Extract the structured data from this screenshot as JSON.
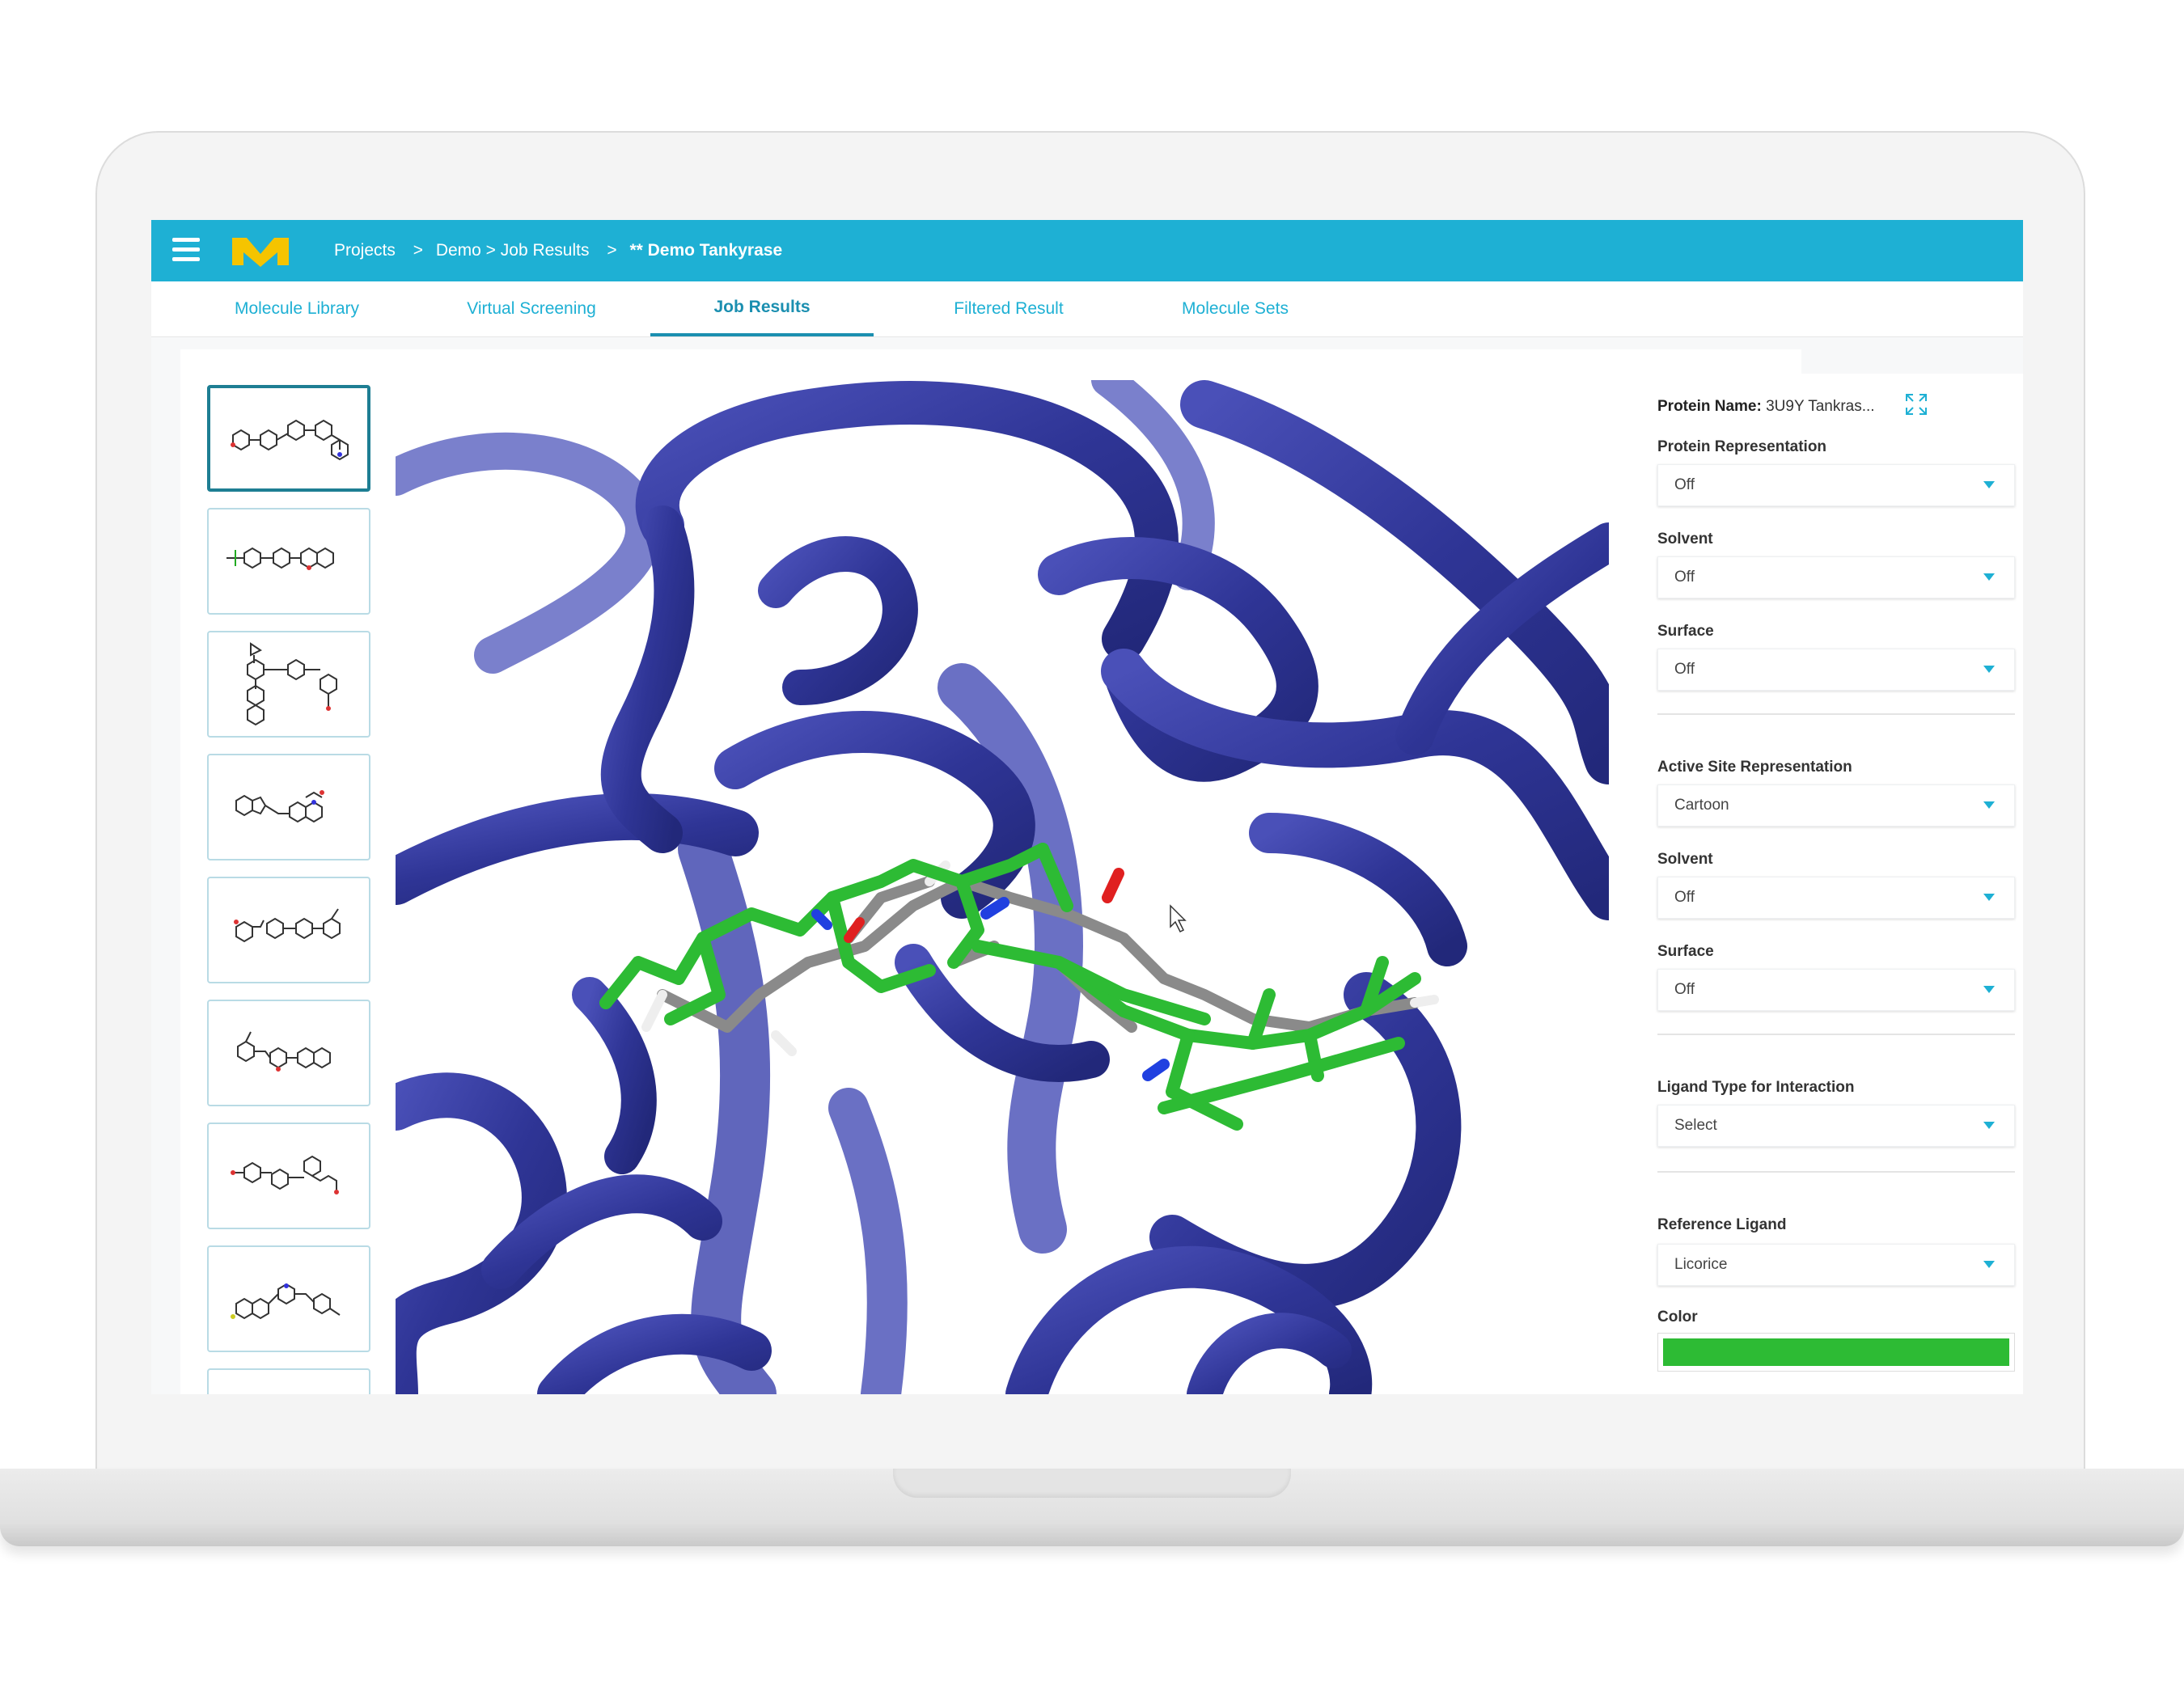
{
  "header": {
    "menu_icon": "hamburger-icon",
    "logo": "M",
    "breadcrumb": [
      "Projects",
      "Demo > Job Results",
      "** Demo Tankyrase"
    ],
    "breadcrumb_separator": ">"
  },
  "tabs": [
    {
      "label": "Molecule Library"
    },
    {
      "label": "Virtual Screening"
    },
    {
      "label": "Job Results",
      "active": true
    },
    {
      "label": "Filtered Result"
    },
    {
      "label": "Molecule Sets"
    }
  ],
  "right_panel": {
    "protein_name_label": "Protein Name:",
    "protein_name_value": "3U9Y Tankras...",
    "protein_representation": {
      "label": "Protein Representation",
      "value": "Off"
    },
    "solvent_1": {
      "label": "Solvent",
      "value": "Off"
    },
    "surface_1": {
      "label": "Surface",
      "value": "Off"
    },
    "active_site_representation": {
      "label": "Active Site Representation",
      "value": "Cartoon"
    },
    "solvent_2": {
      "label": "Solvent",
      "value": "Off"
    },
    "surface_2": {
      "label": "Surface",
      "value": "Off"
    },
    "ligand_type": {
      "label": "Ligand Type for Interaction",
      "value": "Select"
    },
    "reference_ligand": {
      "label": "Reference Ligand",
      "value": "Licorice"
    },
    "color": {
      "label": "Color",
      "value": "#2dbb34"
    }
  },
  "colors": {
    "accent": "#1eb0d4",
    "logo": "#f5c400",
    "protein_ribbon": "#3a3fa0",
    "ligand": "#2dbb34"
  },
  "thumbnails_count": 9
}
